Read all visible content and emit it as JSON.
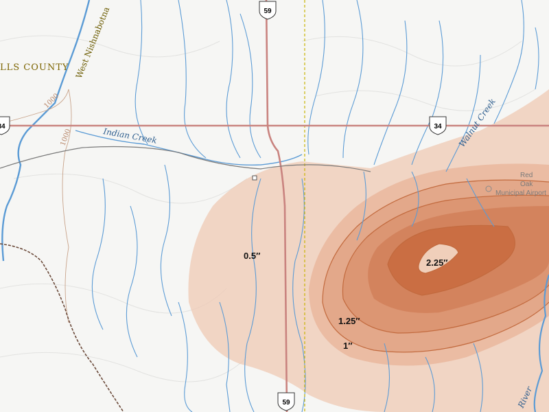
{
  "map": {
    "labels": {
      "county": "LLS COUNTY",
      "river_west_nishnabotna": "West Nishnabotna",
      "creek_indian": "Indian Creek",
      "creek_walnut": "Walnut Creek",
      "river_east": "River",
      "airport_line1": "Red",
      "airport_line2": "Oak",
      "airport_line3": "Municipal Airport",
      "contour_1000_a": "1000",
      "contour_1000_b": "1000"
    },
    "highway_shields": {
      "us59_top": "59",
      "us59_bottom": "59",
      "us34_left": "34",
      "us34_right": "34"
    },
    "isohyet_labels": {
      "label_0_5": "0.5″",
      "label_1_25": "1.25″",
      "label_1": "1″",
      "label_2_25": "2.25″"
    },
    "colors": {
      "background": "#f6f6f4",
      "water": "#5b9bd5",
      "road": "#c9837f",
      "railroad": "#6b4a3a",
      "boundary": "#c8b400",
      "rain_light": "#efc9b4",
      "rain_dark": "#c5622f"
    }
  }
}
